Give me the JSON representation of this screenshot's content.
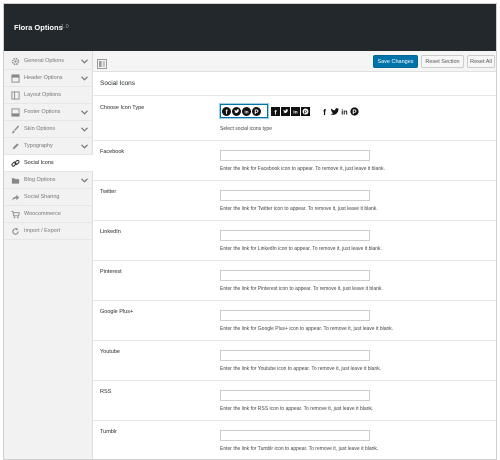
{
  "header": {
    "title": "Flora Options",
    "version": "1.0"
  },
  "sidebar": {
    "items": [
      {
        "label": "General Options",
        "icon": "gear-icon",
        "chevron": true,
        "active": false
      },
      {
        "label": "Header Options",
        "icon": "header-icon",
        "chevron": true,
        "active": false
      },
      {
        "label": "Layout Options",
        "icon": "layout-icon",
        "chevron": false,
        "active": false
      },
      {
        "label": "Footer Options",
        "icon": "footer-icon",
        "chevron": true,
        "active": false
      },
      {
        "label": "Skin Options",
        "icon": "brush-icon",
        "chevron": true,
        "active": false
      },
      {
        "label": "Typography",
        "icon": "pencil-icon",
        "chevron": true,
        "active": false
      },
      {
        "label": "Social Icons",
        "icon": "link-icon",
        "chevron": false,
        "active": true
      },
      {
        "label": "Blog Options",
        "icon": "folder-icon",
        "chevron": true,
        "active": false
      },
      {
        "label": "Social Sharing",
        "icon": "share-icon",
        "chevron": false,
        "active": false
      },
      {
        "label": "Woocommerce",
        "icon": "cart-icon",
        "chevron": false,
        "active": false
      },
      {
        "label": "Import / Export",
        "icon": "refresh-icon",
        "chevron": false,
        "active": false
      }
    ]
  },
  "toolbar": {
    "save_label": "Save Changes",
    "reset_section_label": "Reset Section",
    "reset_all_label": "Reset All"
  },
  "section": {
    "title": "Social Icons"
  },
  "icon_type": {
    "label": "Choose Icon Type",
    "description": "Select social icons type"
  },
  "fields": [
    {
      "label": "Facebook",
      "value": "",
      "description": "Enter the link for Facebook icon to appear. To remove it, just leave it blank."
    },
    {
      "label": "Twitter",
      "value": "",
      "description": "Enter the link for Twitter icon to appear. To remove it, just leave it blank."
    },
    {
      "label": "LinkedIn",
      "value": "",
      "description": "Enter the link for LinkedIn icon to appear. To remove it, just leave it blank."
    },
    {
      "label": "Pinterest",
      "value": "",
      "description": "Enter the link for Pinterest icon to appear. To remove it, just leave it blank."
    },
    {
      "label": "Google Plus+",
      "value": "",
      "description": "Enter the link for Google Plus+ icon to appear. To remove it, just leave it blank."
    },
    {
      "label": "Youtube",
      "value": "",
      "description": "Enter the link for Youtube icon to appear. To remove it, just leave it blank."
    },
    {
      "label": "RSS",
      "value": "",
      "description": "Enter the link for RSS icon to appear. To remove it, just leave it blank."
    },
    {
      "label": "Tumblr",
      "value": "",
      "description": "Enter the link for Tumblr icon to appear. To remove it, just leave it blank."
    }
  ],
  "colors": {
    "header_bg": "#23282d",
    "primary": "#0073aa",
    "sidebar_bg": "#f2f2f2"
  }
}
